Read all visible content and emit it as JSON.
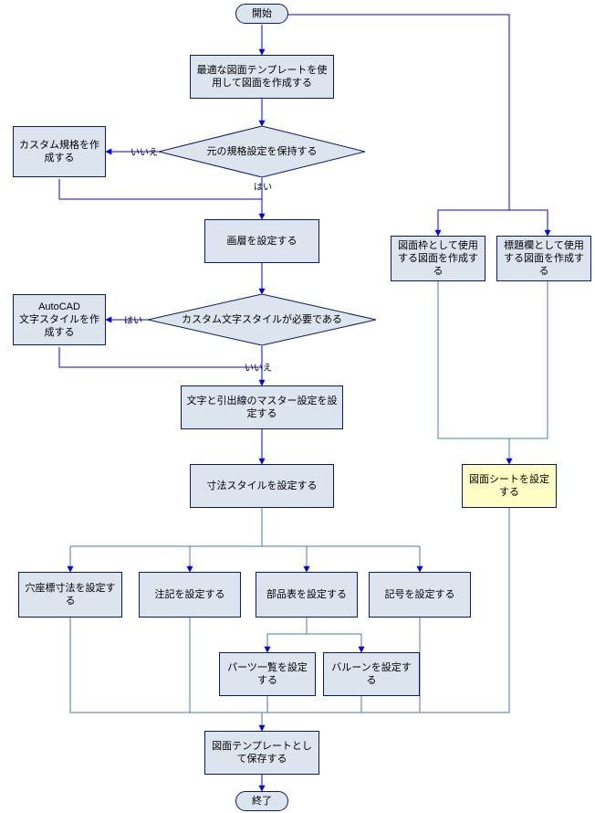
{
  "chart_data": {
    "type": "flowchart",
    "nodes": [
      {
        "id": "start",
        "type": "terminator",
        "label": "開始"
      },
      {
        "id": "n1",
        "type": "process",
        "label": "最適な図面テンプレートを使用して図面を作成する"
      },
      {
        "id": "d1",
        "type": "decision",
        "label": "元の規格設定を保持する"
      },
      {
        "id": "n2",
        "type": "process",
        "label": "カスタム規格を作成する"
      },
      {
        "id": "n3",
        "type": "process",
        "label": "画層を設定する"
      },
      {
        "id": "d2",
        "type": "decision",
        "label": "カスタム文字スタイルが必要である"
      },
      {
        "id": "n4",
        "type": "process",
        "label": "AutoCAD\n文字スタイルを作成する"
      },
      {
        "id": "n5",
        "type": "process",
        "label": "文字と引出線のマスター設定を設定する"
      },
      {
        "id": "n6",
        "type": "process",
        "label": "寸法スタイルを設定する"
      },
      {
        "id": "n7",
        "type": "process",
        "label": "穴座標寸法を設定する"
      },
      {
        "id": "n8",
        "type": "process",
        "label": "注記を設定する"
      },
      {
        "id": "n9",
        "type": "process",
        "label": "部品表を設定する"
      },
      {
        "id": "n10",
        "type": "process",
        "label": "記号を設定する"
      },
      {
        "id": "n11",
        "type": "process",
        "label": "パーツ一覧を設定する"
      },
      {
        "id": "n12",
        "type": "process",
        "label": "バルーンを設定する"
      },
      {
        "id": "n13",
        "type": "process",
        "label": "図面テンプレートとして保存する"
      },
      {
        "id": "r1",
        "type": "process",
        "label": "図面枠として使用する図面を作成する"
      },
      {
        "id": "r2",
        "type": "process",
        "label": "標題欄として使用する図面を作成する"
      },
      {
        "id": "r3",
        "type": "process-highlight",
        "label": "図面シートを設定する"
      },
      {
        "id": "end",
        "type": "terminator",
        "label": "終了"
      }
    ],
    "edges": [
      {
        "from": "start",
        "to": "n1"
      },
      {
        "from": "start",
        "to": "r1"
      },
      {
        "from": "start",
        "to": "r2"
      },
      {
        "from": "n1",
        "to": "d1"
      },
      {
        "from": "d1",
        "to": "n2",
        "label": "いいえ"
      },
      {
        "from": "d1",
        "to": "n3",
        "label": "はい"
      },
      {
        "from": "n2",
        "to": "n3"
      },
      {
        "from": "n3",
        "to": "d2"
      },
      {
        "from": "d2",
        "to": "n4",
        "label": "はい"
      },
      {
        "from": "d2",
        "to": "n5",
        "label": "いいえ"
      },
      {
        "from": "n4",
        "to": "n5"
      },
      {
        "from": "n5",
        "to": "n6"
      },
      {
        "from": "n6",
        "to": "n7"
      },
      {
        "from": "n6",
        "to": "n8"
      },
      {
        "from": "n6",
        "to": "n9"
      },
      {
        "from": "n6",
        "to": "n10"
      },
      {
        "from": "n9",
        "to": "n11"
      },
      {
        "from": "n9",
        "to": "n12"
      },
      {
        "from": "n7",
        "to": "n13"
      },
      {
        "from": "n8",
        "to": "n13"
      },
      {
        "from": "n11",
        "to": "n13"
      },
      {
        "from": "n12",
        "to": "n13"
      },
      {
        "from": "n10",
        "to": "n13"
      },
      {
        "from": "r1",
        "to": "r3"
      },
      {
        "from": "r2",
        "to": "r3"
      },
      {
        "from": "r3",
        "to": "n13"
      },
      {
        "from": "n13",
        "to": "end"
      }
    ],
    "edge_labels": {
      "yes": "はい",
      "no": "いいえ"
    }
  },
  "terms": {
    "start": "開始",
    "end": "終了"
  }
}
